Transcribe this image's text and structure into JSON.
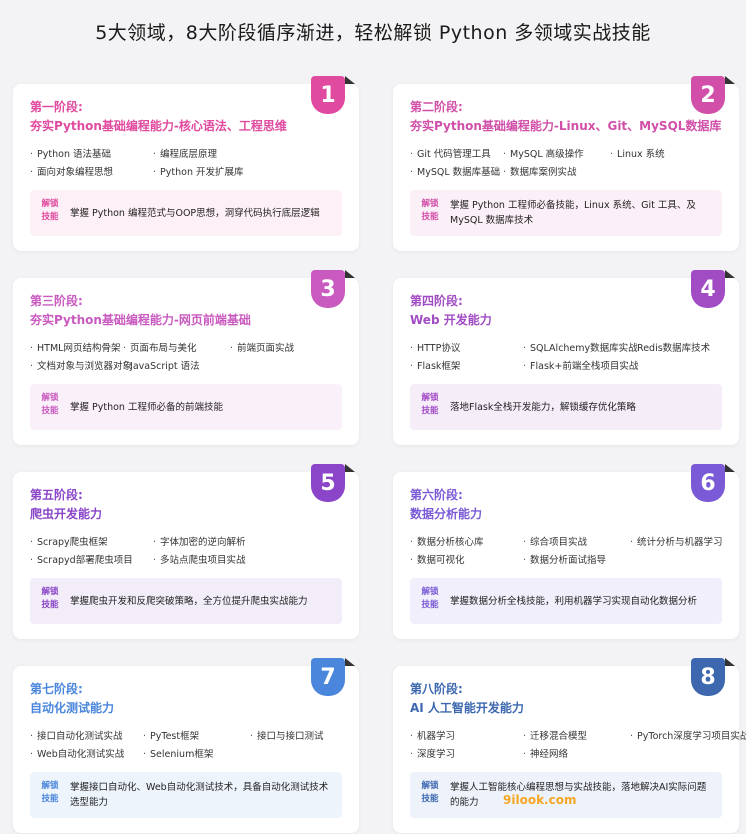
{
  "title": "5大领域，8大阶段循序渐进，轻松解锁 Python 多领域实战技能",
  "unlock_label": "解锁技能",
  "watermark": "9ilook.com",
  "stages": [
    {
      "number": "1",
      "stage": "第一阶段:",
      "heading": "夯实Python基础编程能力-核心语法、工程思维",
      "color": "#e04a9f",
      "bullets": [
        [
          "Python 语法基础",
          "编程底层原理"
        ],
        [
          "面向对象编程思想",
          "Python 开发扩展库"
        ]
      ],
      "unlock": "掌握 Python 编程范式与OOP思想，洞穿代码执行底层逻辑",
      "unlock_bg": "#fdf0f7"
    },
    {
      "number": "2",
      "stage": "第二阶段:",
      "heading": "夯实Python基础编程能力-Linux、Git、MySQL数据库",
      "color": "#d14fa8",
      "bullets": [
        [
          "Git 代码管理工具",
          "MySQL 高级操作",
          "Linux 系统"
        ],
        [
          "MySQL 数据库基础",
          "数据库案例实战"
        ]
      ],
      "unlock": "掌握 Python 工程师必备技能，Linux 系统、Git 工具、及 MySQL 数据库技术",
      "unlock_bg": "#fcf0f8"
    },
    {
      "number": "3",
      "stage": "第三阶段:",
      "heading": "夯实Python基础编程能力-网页前端基础",
      "color": "#c95ac0",
      "bullets": [
        [
          "HTML网页结构骨架",
          "页面布局与美化",
          "前端页面实战"
        ],
        [
          "文档对象与浏览器对象",
          "JavaScript 语法"
        ]
      ],
      "unlock": "掌握 Python 工程师必备的前端技能",
      "unlock_bg": "#faf0fa"
    },
    {
      "number": "4",
      "stage": "第四阶段:",
      "heading": "Web 开发能力",
      "color": "#a24cc4",
      "bullets": [
        [
          "HTTP协议",
          "SQLAlchemy数据库实战",
          "Redis数据库技术"
        ],
        [
          "Flask框架",
          "Flask+前端全栈项目实战"
        ]
      ],
      "unlock": "落地Flask全栈开发能力，解锁缓存优化策略",
      "unlock_bg": "#f5eef9"
    },
    {
      "number": "5",
      "stage": "第五阶段:",
      "heading": "爬虫开发能力",
      "color": "#8a45c8",
      "bullets": [
        [
          "Scrapy爬虫框架",
          "字体加密的逆向解析"
        ],
        [
          "Scrapyd部署爬虫项目",
          "多站点爬虫项目实战"
        ]
      ],
      "unlock": "掌握爬虫开发和反爬突破策略，全方位提升爬虫实战能力",
      "unlock_bg": "#f2edf9"
    },
    {
      "number": "6",
      "stage": "第六阶段:",
      "heading": "数据分析能力",
      "color": "#7a5ad6",
      "bullets": [
        [
          "数据分析核心库",
          "综合项目实战",
          "统计分析与机器学习"
        ],
        [
          "数据可视化",
          "数据分析面试指导"
        ]
      ],
      "unlock": "掌握数据分析全栈技能，利用机器学习实现自动化数据分析",
      "unlock_bg": "#f0effb"
    },
    {
      "number": "7",
      "stage": "第七阶段:",
      "heading": "自动化测试能力",
      "color": "#4a86dc",
      "bullets": [
        [
          "接口自动化测试实战",
          "PyTest框架",
          "接口与接口测试"
        ],
        [
          "Web自动化测试实战",
          "Selenium框架"
        ]
      ],
      "unlock": "掌握接口自动化、Web自动化测试技术，具备自动化测试技术选型能力",
      "unlock_bg": "#eef4fc"
    },
    {
      "number": "8",
      "stage": "第八阶段:",
      "heading": "AI 人工智能开发能力",
      "color": "#3d68b0",
      "bullets": [
        [
          "机器学习",
          "迁移混合模型",
          "PyTorch深度学习项目实战"
        ],
        [
          "深度学习",
          "神经网络"
        ]
      ],
      "unlock": "掌握人工智能核心编程思想与实战技能，落地解决AI实际问题的能力",
      "unlock_bg": "#eef2fa"
    }
  ]
}
